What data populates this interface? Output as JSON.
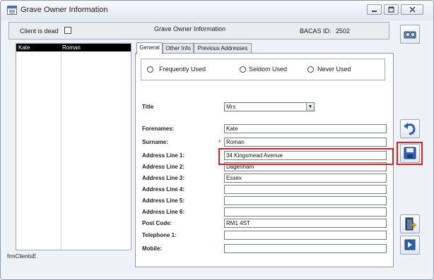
{
  "window": {
    "title": "Grave Owner Information"
  },
  "header": {
    "client_is_dead_label": "Client is dead",
    "section_title": "Grave Owner Information",
    "bacas_label": "BACAS ID:",
    "bacas_value": "2502"
  },
  "client_list": {
    "rows": [
      {
        "first": "Kate",
        "last": "Roman"
      }
    ]
  },
  "tabs": [
    {
      "label": "General"
    },
    {
      "label": "Other Info"
    },
    {
      "label": "Previous Addresses"
    }
  ],
  "frequency": {
    "options": [
      "Frequently Used",
      "Seldom Used",
      "Never Used"
    ]
  },
  "form": {
    "title_label": "Title",
    "title_value": "Mrs",
    "forenames_label": "Forenames:",
    "forenames_value": "Kate",
    "surname_label": "Surname:",
    "surname_value": "Roman",
    "address1_label": "Address Line 1:",
    "address1_value": "34 Kingsmead Avenue",
    "address2_label": "Address Line 2:",
    "address2_value": "Dagenham",
    "address3_label": "Address Line 3:",
    "address3_value": "Essex",
    "address4_label": "Address Line 4:",
    "address4_value": "",
    "address5_label": "Address Line 5:",
    "address5_value": "",
    "address6_label": "Address Line 6:",
    "address6_value": "",
    "postcode_label": "Post Code:",
    "postcode_value": "RM1 4ST",
    "telephone_label": "Telephone 1:",
    "telephone_value": "",
    "mobile_label": "Mobile:",
    "mobile_value": ""
  },
  "footer": {
    "form_name": "frmClientsE"
  },
  "toolbar_icons": [
    "search-icon",
    "undo-icon",
    "save-icon",
    "exit-door-icon",
    "next-icon"
  ],
  "colors": {
    "highlight": "#e02020",
    "selected_row_bg": "#000000",
    "required_star": "#dd1111"
  }
}
